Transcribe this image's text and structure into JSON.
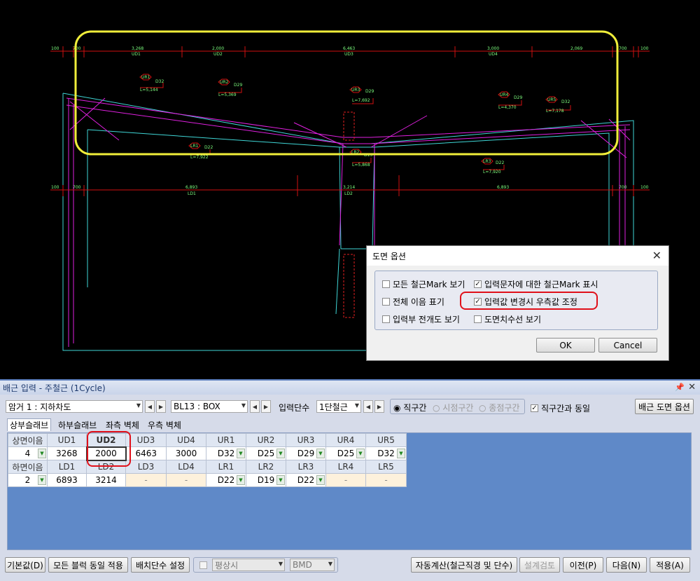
{
  "cad": {
    "top_dims": [
      "100",
      "700",
      "3,268",
      "2,000",
      "6,463",
      "3,000",
      "2,069",
      "700",
      "100"
    ],
    "top_labels": [
      "UD1",
      "UD2",
      "UD3",
      "UD4"
    ],
    "bottom_dims": [
      "100",
      "700",
      "6,893",
      "3,214",
      "6,893",
      "700",
      "100"
    ],
    "bottom_labels": [
      "LD1",
      "LD2"
    ],
    "marks": [
      {
        "id": "UR1",
        "bar": "D32",
        "len": "L=5,144"
      },
      {
        "id": "UR2",
        "bar": "D29",
        "len": "L=5,369"
      },
      {
        "id": "UR3",
        "bar": "D29",
        "len": "L=7,692"
      },
      {
        "id": "UR4",
        "bar": "D29",
        "len": "L=4,370"
      },
      {
        "id": "UR5",
        "bar": "D32",
        "len": "L=7,178"
      },
      {
        "id": "LR1",
        "bar": "D22",
        "len": "L=7,922"
      },
      {
        "id": "LR2",
        "bar": "D19",
        "len": "L=5,868"
      },
      {
        "id": "LR3",
        "bar": "D22",
        "len": "L=7,920"
      }
    ]
  },
  "dialog": {
    "title": "도면 옵션",
    "options": [
      {
        "label": "모든 철근Mark 보기",
        "checked": false
      },
      {
        "label": "입력문자에 대한 철근Mark 표시",
        "checked": true
      },
      {
        "label": "전체 이음 표기",
        "checked": false
      },
      {
        "label": "입력값 변경시 우측값 조정",
        "checked": true
      },
      {
        "label": "입력부 전개도 보기",
        "checked": false
      },
      {
        "label": "도면치수선 보기",
        "checked": false
      }
    ],
    "ok": "OK",
    "cancel": "Cancel"
  },
  "panel": {
    "title": "배근 입력 - 주철근 (1Cycle)",
    "pin": "ᅟ",
    "close": "×",
    "block_select": "암거 1 : 지하차도",
    "section_select": "BL13 : BOX",
    "input_stage_label": "입력단수",
    "input_stage_select": "1단철근",
    "radio_straight": "직구간",
    "radio_start": "시점구간",
    "radio_end": "종점구간",
    "same_as_straight": "직구간과 동일",
    "drawing_options_button": "배근 도면 옵션",
    "tabs": [
      "상부슬래브",
      "하부슬래브",
      "좌측 벽체",
      "우측 벽체"
    ],
    "grid": {
      "upper_lap_label": "상면이음",
      "upper_headers": [
        "UD1",
        "UD2",
        "UD3",
        "UD4",
        "UR1",
        "UR2",
        "UR3",
        "UR4",
        "UR5"
      ],
      "upper_lap_value": "4",
      "upper_values": [
        "3268",
        "2000",
        "6463",
        "3000",
        "D32",
        "D25",
        "D29",
        "D25",
        "D32"
      ],
      "lower_lap_label": "하면이음",
      "lower_headers": [
        "LD1",
        "LD2",
        "LD3",
        "LD4",
        "LR1",
        "LR2",
        "LR3",
        "LR4",
        "LR5"
      ],
      "lower_lap_value": "2",
      "lower_values": [
        "6893",
        "3214",
        "-",
        "-",
        "D22",
        "D19",
        "D22",
        "-",
        "-"
      ]
    },
    "buttons": {
      "default": "기본값(D)",
      "apply_all": "모든 블럭 동일 적용",
      "stage_setting": "배치단수 설정",
      "plain": "평상시",
      "bmd": "BMD",
      "auto_calc": "자동계산(철근직경 및 단수)",
      "design_check": "설계검토",
      "prev": "이전(P)",
      "next": "다음(N)",
      "apply": "적용(A)"
    }
  }
}
